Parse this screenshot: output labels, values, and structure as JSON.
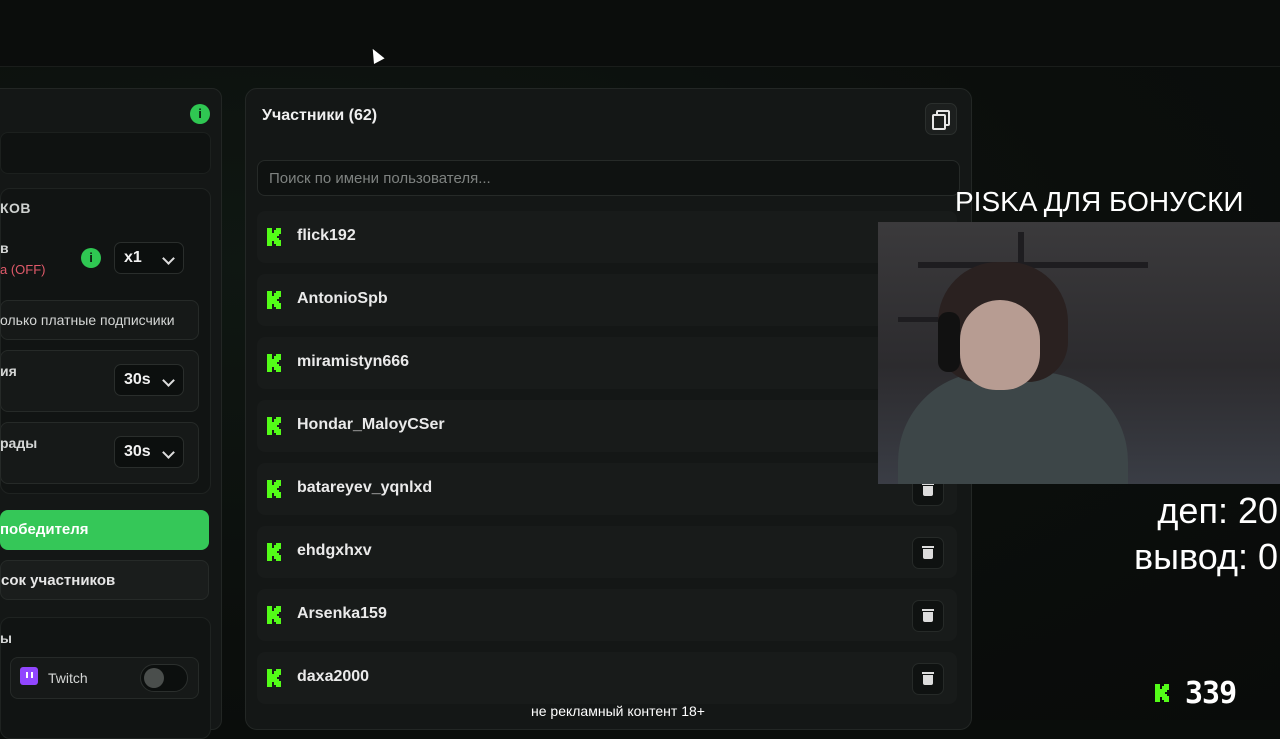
{
  "left_panel": {
    "section_heading": "КОВ",
    "row1_label": "в",
    "row1_sub": "а (OFF)",
    "multiplier": "x1",
    "paid_only": "олько платные подписчики",
    "row3_label": "ия",
    "timer1": "30s",
    "row4_label": "рады",
    "timer2": "30s",
    "winner_button": "победителя",
    "list_button": "сок участников",
    "section2_heading": "ы",
    "platform_twitch": "Twitch",
    "info_icon": "i"
  },
  "participants": {
    "title": "Участники (62)",
    "search_placeholder": "Поиск по имени пользователя...",
    "items": [
      {
        "name": "flick192"
      },
      {
        "name": "AntonioSpb"
      },
      {
        "name": "miramistyn666"
      },
      {
        "name": "Hondar_MaloyCSer"
      },
      {
        "name": "batareyev_yqnlxd"
      },
      {
        "name": "ehdgxhxv"
      },
      {
        "name": "Arsenka159"
      },
      {
        "name": "daxa2000"
      }
    ]
  },
  "overlay": {
    "bonus_title": "PISKA ДЛЯ БОНУСКИ",
    "dep": "деп: 20",
    "vyvod": "вывод: 0",
    "kick_count": "339",
    "disclaimer": "не рекламный контент 18+"
  },
  "colors": {
    "accent_green": "#35c758",
    "kick_green": "#53fc18",
    "danger_text": "#e05a6a",
    "twitch_purple": "#9146ff"
  },
  "icons": {
    "copy": "copy-icon",
    "trash": "trash-icon",
    "kick": "kick-logo-icon",
    "info": "info-icon",
    "chevron": "chevron-down-icon",
    "twitch": "twitch-icon"
  }
}
